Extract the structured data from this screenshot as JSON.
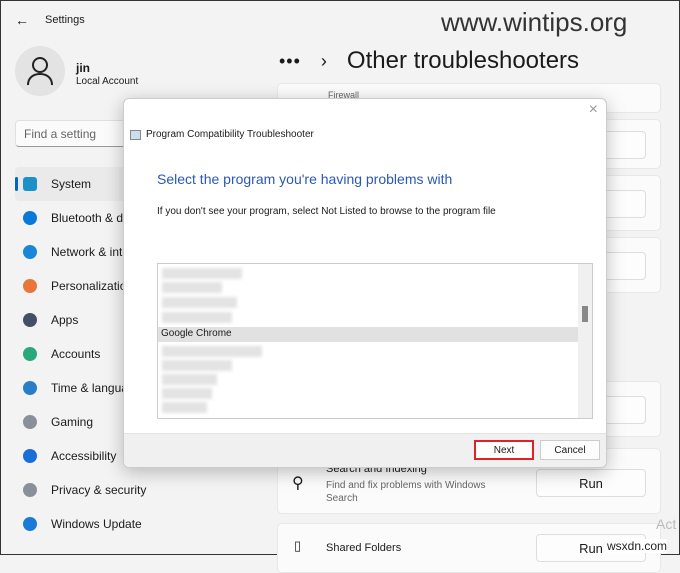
{
  "window": {
    "title": "Settings"
  },
  "user": {
    "name": "jin",
    "type": "Local Account"
  },
  "search": {
    "placeholder": "Find a setting"
  },
  "sidebar": {
    "items": [
      {
        "label": "System",
        "icon": "system-icon",
        "color": "#1e90c8"
      },
      {
        "label": "Bluetooth & devices",
        "icon": "bluetooth-icon",
        "color": "#0a7ad8"
      },
      {
        "label": "Network & internet",
        "icon": "wifi-icon",
        "color": "#1a86d8"
      },
      {
        "label": "Personalization",
        "icon": "brush-icon",
        "color": "#e8753a"
      },
      {
        "label": "Apps",
        "icon": "apps-icon",
        "color": "#444f66"
      },
      {
        "label": "Accounts",
        "icon": "accounts-icon",
        "color": "#2aa87a"
      },
      {
        "label": "Time & language",
        "icon": "clock-globe-icon",
        "color": "#2a7ec8"
      },
      {
        "label": "Gaming",
        "icon": "gamepad-icon",
        "color": "#8a9099"
      },
      {
        "label": "Accessibility",
        "icon": "accessibility-icon",
        "color": "#1a6ed8"
      },
      {
        "label": "Privacy & security",
        "icon": "shield-icon",
        "color": "#8a9099"
      },
      {
        "label": "Windows Update",
        "icon": "update-icon",
        "color": "#1a7ad8"
      }
    ]
  },
  "header": {
    "more": "•••",
    "separator": "›",
    "title": "Other troubleshooters"
  },
  "cards": [
    {
      "label": "Firewall"
    },
    {
      "title": "Search and Indexing",
      "desc": "Find and fix problems with Windows Search",
      "button": "Run"
    },
    {
      "title": "Shared Folders",
      "button": "Run"
    }
  ],
  "dialog": {
    "title": "Program Compatibility Troubleshooter",
    "heading": "Select the program you're having problems with",
    "instruction": "If you don't see your program, select Not Listed to browse to the program file",
    "selected_item": "Google Chrome",
    "next": "Next",
    "cancel": "Cancel",
    "heading_color": "#2b57b8",
    "highlight_color": "#e0202a"
  },
  "watermark": {
    "top": "www.wintips.org",
    "bottom": "wsxdn.com",
    "activate": "Act"
  }
}
